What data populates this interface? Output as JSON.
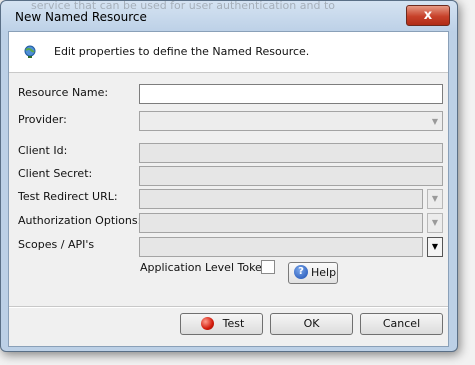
{
  "window": {
    "title": "New Named Resource",
    "close_glyph": "x",
    "background_text": "service that can be used for user authentication and to"
  },
  "header": {
    "icon": "globe-icon",
    "text": "Edit properties to define the Named Resource."
  },
  "form": {
    "resource_name_label": "Resource Name:",
    "resource_name_value": "",
    "provider_label": "Provider:",
    "provider_value": "",
    "client_id_label": "Client Id:",
    "client_secret_label": "Client Secret:",
    "test_redirect_url_label": "Test Redirect URL:",
    "authorization_options_label": "Authorization Options:",
    "scopes_label": "Scopes / API's",
    "app_level_token_label": "Application Level Token:",
    "app_level_token_checked": false
  },
  "buttons": {
    "help": "Help",
    "test": "Test",
    "ok": "OK",
    "cancel": "Cancel"
  },
  "colors": {
    "title_bar": "#bdd1e7",
    "close_button": "#c7412a",
    "client_background": "#f0f0f0"
  }
}
